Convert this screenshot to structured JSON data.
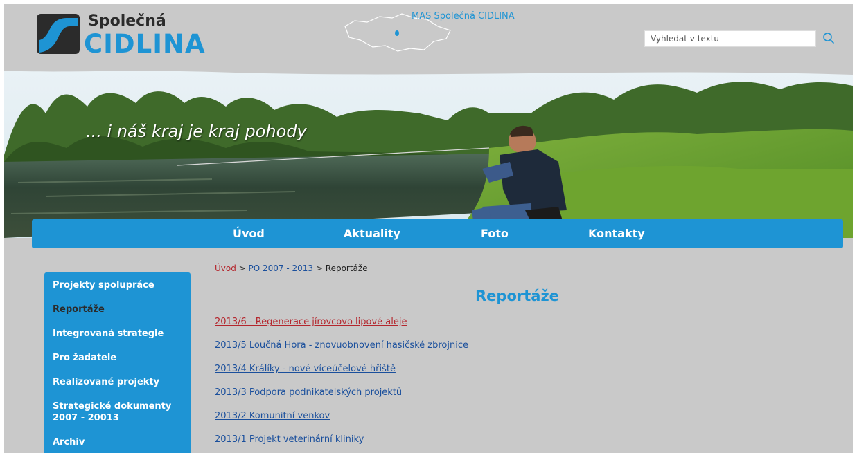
{
  "header": {
    "logo_top": "Společná",
    "logo_bottom": "CIDLINA",
    "map_label": "MAS Společná CIDLINA",
    "search": {
      "placeholder": "Vyhledat v textu",
      "icon": "search-icon"
    }
  },
  "hero": {
    "slogan": "... i náš kraj je kraj pohody"
  },
  "nav": {
    "items": [
      {
        "label": "Úvod"
      },
      {
        "label": "Aktuality"
      },
      {
        "label": "Foto"
      },
      {
        "label": "Kontakty"
      }
    ]
  },
  "breadcrumb": {
    "home": "Úvod",
    "sep1": " > ",
    "parent": "PO 2007 - 2013",
    "sep2": " > ",
    "current": "Reportáže"
  },
  "main": {
    "title": "Reportáže",
    "articles": [
      {
        "label": "2013/6 - Regenerace jírovcovo lipové aleje"
      },
      {
        "label": "2013/5 Loučná Hora - znovuobnovení hasičské zbrojnice"
      },
      {
        "label": "2013/4 Králíky - nové víceúčelové hřiště"
      },
      {
        "label": "2013/3 Podpora podnikatelských projektů"
      },
      {
        "label": "2013/2 Komunitní venkov"
      },
      {
        "label": "2013/1 Projekt veterinární kliniky"
      }
    ]
  },
  "sidebar": {
    "items": [
      {
        "label": "Projekty spolupráce"
      },
      {
        "label": "Reportáže"
      },
      {
        "label": "Integrovaná strategie"
      },
      {
        "label": "Pro žadatele"
      },
      {
        "label": "Realizované projekty"
      },
      {
        "label": "Strategické dokumenty 2007 - 20013"
      },
      {
        "label": "Archiv"
      }
    ]
  },
  "colors": {
    "accent": "#1e94d4",
    "background": "#c9c9c9",
    "link": "#1a4f9c",
    "visited_link": "#b4262d",
    "active_side": "#2b2b2b"
  }
}
